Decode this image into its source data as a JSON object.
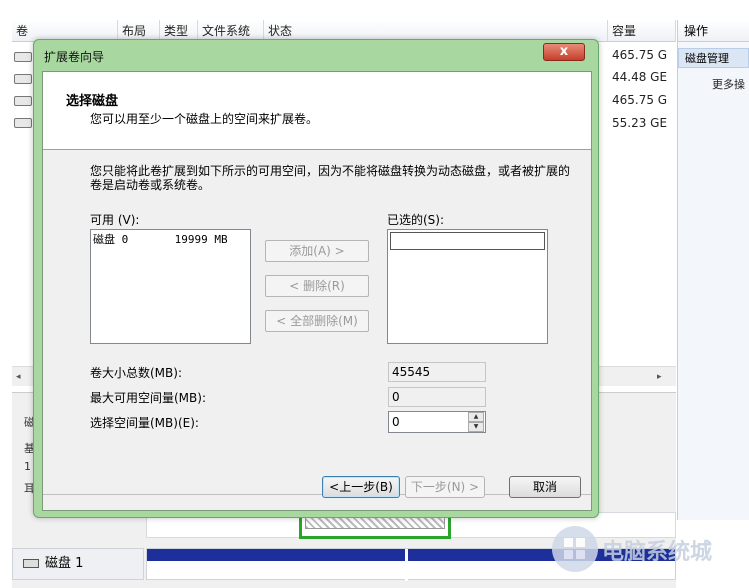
{
  "background": {
    "columns": [
      "卷",
      "布局",
      "类型",
      "文件系统",
      "状态",
      "容量"
    ],
    "capacities": [
      "465.75 G",
      "44.48 GE",
      "465.75 G",
      "55.23 GE"
    ],
    "actions": {
      "header": "操作",
      "disk_management": "磁盘管理",
      "more": "更多操"
    },
    "disk1_label": "磁盘 1",
    "fragments": [
      "磁",
      "基",
      "1",
      "耳"
    ]
  },
  "wizard": {
    "title": "扩展卷向导",
    "close_symbol": "x",
    "step_title": "选择磁盘",
    "step_desc": "您可以用至少一个磁盘上的空间来扩展卷。",
    "intro": "您只能将此卷扩展到如下所示的可用空间，因为不能将磁盘转换为动态磁盘，或者被扩展的卷是启动卷或系统卷。",
    "available_label": "可用 (V):",
    "available_items": [
      "磁盘 0       19999 MB"
    ],
    "selected_label": "已选的(S):",
    "add_button": "添加(A) >",
    "remove_button": "< 删除(R)",
    "remove_all_button": "< 全部删除(M)",
    "total_size_label": "卷大小总数(MB):",
    "total_size_value": "45545",
    "max_space_label": "最大可用空间量(MB):",
    "max_space_value": "0",
    "select_space_label": "选择空间量(MB)(E):",
    "select_space_value": "0",
    "back_button": "<上一步(B)",
    "next_button": "下一步(N) >",
    "cancel_button": "取消"
  },
  "watermark": "电脑系统城"
}
